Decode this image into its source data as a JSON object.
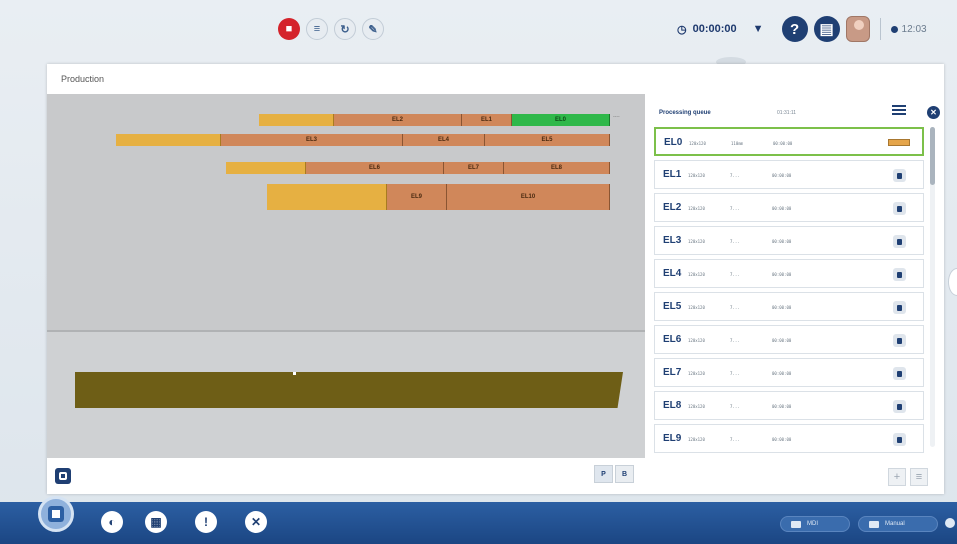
{
  "top": {
    "center_icons": [
      "stop-icon",
      "layers-icon",
      "refresh-icon",
      "wrench-icon"
    ],
    "timer": "00:00:00",
    "clock": "12:03",
    "help_label": "?"
  },
  "production": {
    "title": "Production",
    "rows": [
      [
        {
          "label": "",
          "kind": "gold"
        },
        {
          "label": "EL2",
          "kind": "copper"
        },
        {
          "label": "EL1",
          "kind": "copper"
        },
        {
          "label": "EL0",
          "kind": "green"
        }
      ],
      [
        {
          "label": "",
          "kind": "gold"
        },
        {
          "label": "EL3",
          "kind": "copper"
        },
        {
          "label": "EL4",
          "kind": "copper"
        },
        {
          "label": "EL5",
          "kind": "copper"
        }
      ],
      [
        {
          "label": "",
          "kind": "gold"
        },
        {
          "label": "EL6",
          "kind": "copper"
        },
        {
          "label": "EL7",
          "kind": "copper"
        },
        {
          "label": "EL8",
          "kind": "copper"
        }
      ],
      [
        {
          "label": "",
          "kind": "gold"
        },
        {
          "label": "EL9",
          "kind": "copper"
        },
        {
          "label": "EL10",
          "kind": "copper"
        }
      ]
    ],
    "toggle": {
      "p": "P",
      "b": "B"
    }
  },
  "queue": {
    "title": "Processing queue",
    "time": "01:31:11",
    "items": [
      {
        "name": "EL0",
        "size": "120x120",
        "thickness": "110mm",
        "duration": "00:00:00",
        "active": true
      },
      {
        "name": "EL1",
        "size": "120x120",
        "thickness": "7...",
        "duration": "00:00:00",
        "active": false
      },
      {
        "name": "EL2",
        "size": "120x120",
        "thickness": "7...",
        "duration": "00:00:00",
        "active": false
      },
      {
        "name": "EL3",
        "size": "120x120",
        "thickness": "7...",
        "duration": "00:00:00",
        "active": false
      },
      {
        "name": "EL4",
        "size": "120x120",
        "thickness": "7...",
        "duration": "00:00:00",
        "active": false
      },
      {
        "name": "EL5",
        "size": "120x120",
        "thickness": "7...",
        "duration": "00:00:00",
        "active": false
      },
      {
        "name": "EL6",
        "size": "120x120",
        "thickness": "7...",
        "duration": "00:00:00",
        "active": false
      },
      {
        "name": "EL7",
        "size": "120x120",
        "thickness": "7...",
        "duration": "00:00:00",
        "active": false
      },
      {
        "name": "EL8",
        "size": "120x120",
        "thickness": "7...",
        "duration": "00:00:00",
        "active": false
      },
      {
        "name": "EL9",
        "size": "120x120",
        "thickness": "7...",
        "duration": "00:00:00",
        "active": false
      }
    ],
    "add_label": "+",
    "menu_label": "≡"
  },
  "bottom": {
    "nav_icons": [
      "globe-icon",
      "chart-icon",
      "alert-icon",
      "tools-icon"
    ],
    "nav_glyphs": [
      "◐",
      "▦",
      "!",
      "✕"
    ],
    "mdi_label": "MDI",
    "manual_label": "Manual"
  },
  "colors": {
    "navy": "#1f3f73",
    "copper": "#d0875a",
    "gold": "#e6b042",
    "green": "#2fb84a",
    "sheet": "#6e5e16"
  }
}
